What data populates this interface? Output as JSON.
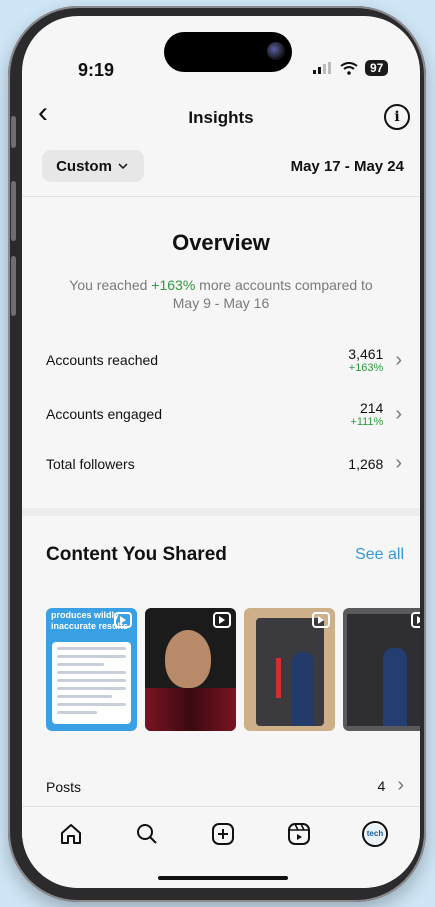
{
  "status_bar": {
    "time": "9:19",
    "battery": "97"
  },
  "nav": {
    "title": "Insights"
  },
  "filter": {
    "range_button": "Custom",
    "date_range": "May 17 - May 24"
  },
  "overview": {
    "title": "Overview",
    "desc_prefix": "You reached ",
    "desc_change": "+163%",
    "desc_suffix": " more accounts compared to May 9 - May 16"
  },
  "metrics": [
    {
      "label": "Accounts reached",
      "value": "3,461",
      "change": "+163%"
    },
    {
      "label": "Accounts engaged",
      "value": "214",
      "change": "+111%"
    },
    {
      "label": "Total followers",
      "value": "1,268",
      "change": ""
    }
  ],
  "content_shared": {
    "title": "Content You Shared",
    "see_all": "See all",
    "thumb1_caption": "produces wildly inaccurate results"
  },
  "posts": {
    "label": "Posts",
    "count": "4"
  },
  "tabbar": {
    "profile_badge": "tech"
  },
  "colors": {
    "accent_green": "#2e9a3e",
    "link_blue": "#3797d9"
  }
}
